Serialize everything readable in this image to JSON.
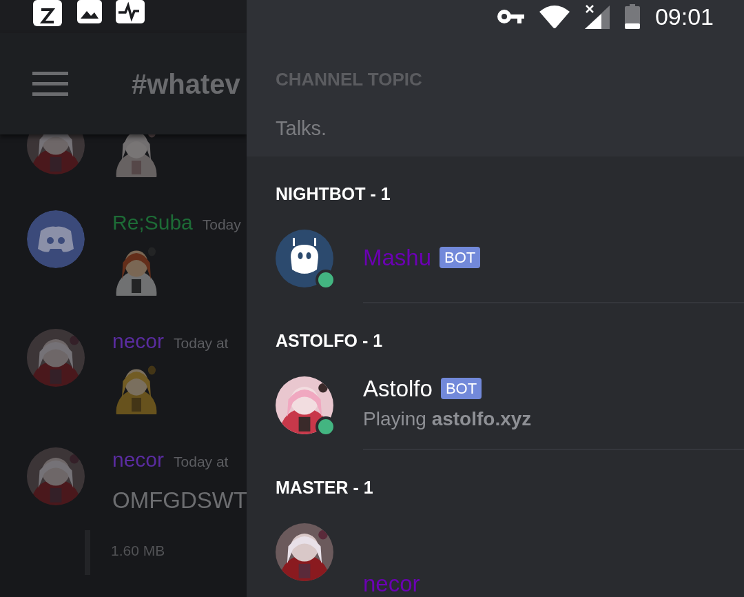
{
  "status_bar": {
    "time": "09:01"
  },
  "chat": {
    "channel": "#whatev",
    "messages": [
      {
        "kind": "sticker"
      },
      {
        "avatar": {
          "kind": "logo"
        },
        "author": "Re;Suba",
        "color": "#1d6b36",
        "time": "Today",
        "kind": "sticker"
      },
      {
        "author": "necor",
        "color": "#5a2ca0",
        "time": "Today at",
        "kind": "sticker"
      },
      {
        "author": "necor",
        "color": "#5a2ca0",
        "time": "Today at",
        "kind": "text",
        "text": "OMFGDSWT",
        "attachment": "1.60 MB"
      }
    ]
  },
  "drawer": {
    "topic_label": "CHANNEL TOPIC",
    "topic": "Talks.",
    "groups": [
      {
        "title": "NIGHTBOT - 1",
        "members": [
          {
            "avatar": {
              "kind": "robot"
            },
            "name": "Mashu",
            "color": "#6b00b3",
            "tag": "BOT",
            "online": true
          }
        ]
      },
      {
        "title": "ASTOLFO - 1",
        "members": [
          {
            "name": "Astolfo",
            "color": "#ffffff",
            "tag": "BOT",
            "online": true,
            "activity": "Playing **astolfo.xyz**"
          }
        ]
      },
      {
        "title": "MASTER - 1",
        "members": [
          {
            "name": "necor",
            "color": "#6b00b3"
          }
        ]
      }
    ]
  }
}
